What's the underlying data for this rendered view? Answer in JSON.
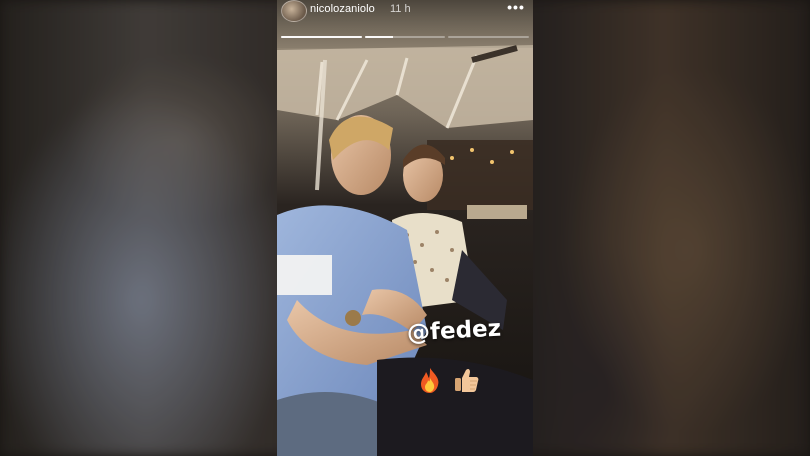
{
  "story": {
    "username": "nicolozaniolo",
    "time_ago": "11 h",
    "more_glyph": "•••",
    "progress": [
      1.0,
      0.35,
      0.0
    ],
    "mention": "@fedez"
  },
  "icons": {
    "more": "more-options-icon",
    "fire": "fire-emoji",
    "thumbs_up": "thumbs-up-emoji"
  },
  "colors": {
    "text": "#ffffff",
    "progress_track": "#ffffff59",
    "progress_fill": "#fffffff2"
  }
}
